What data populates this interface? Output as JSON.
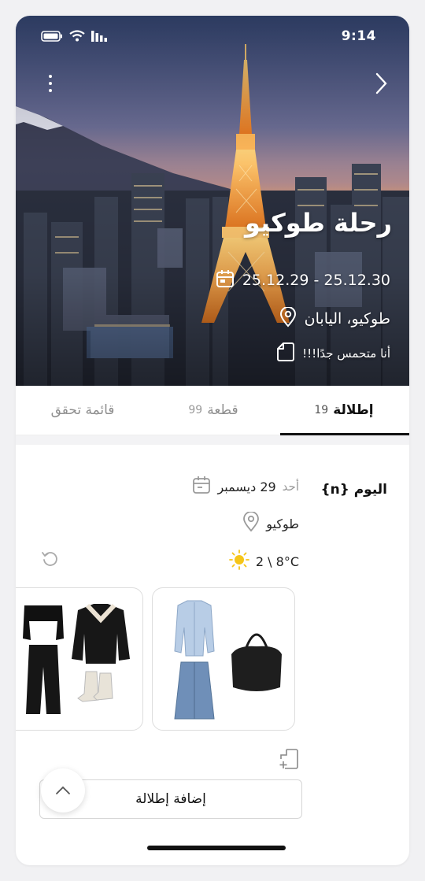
{
  "status_bar": {
    "time": "9:14"
  },
  "hero": {
    "title": "رحلة طوكيو",
    "dates": "25.12.29 - 25.12.30",
    "location": "طوكيو، اليابان",
    "note": "أنا متحمس جدًا!!!"
  },
  "tabs": [
    {
      "label": "إطلالة",
      "count": "19"
    },
    {
      "label": "قطعة",
      "count": "99"
    },
    {
      "label": "قائمة تحقق",
      "count": ""
    }
  ],
  "day": {
    "label": "اليوم {n}",
    "date": "29 ديسمبر",
    "weekday": "أحد",
    "place": "طوكيو",
    "weather": "2 \\ 8°C"
  },
  "actions": {
    "add_outfit": "إضافة إطلالة"
  },
  "icons": {
    "back": "chevron-right-icon",
    "more": "more-vertical-icon",
    "calendar": "calendar-icon",
    "location": "location-pin-icon",
    "note": "note-icon",
    "sun": "sun-icon",
    "refresh": "refresh-icon",
    "add_doc": "add-document-icon",
    "scroll_top": "chevron-up-icon"
  }
}
